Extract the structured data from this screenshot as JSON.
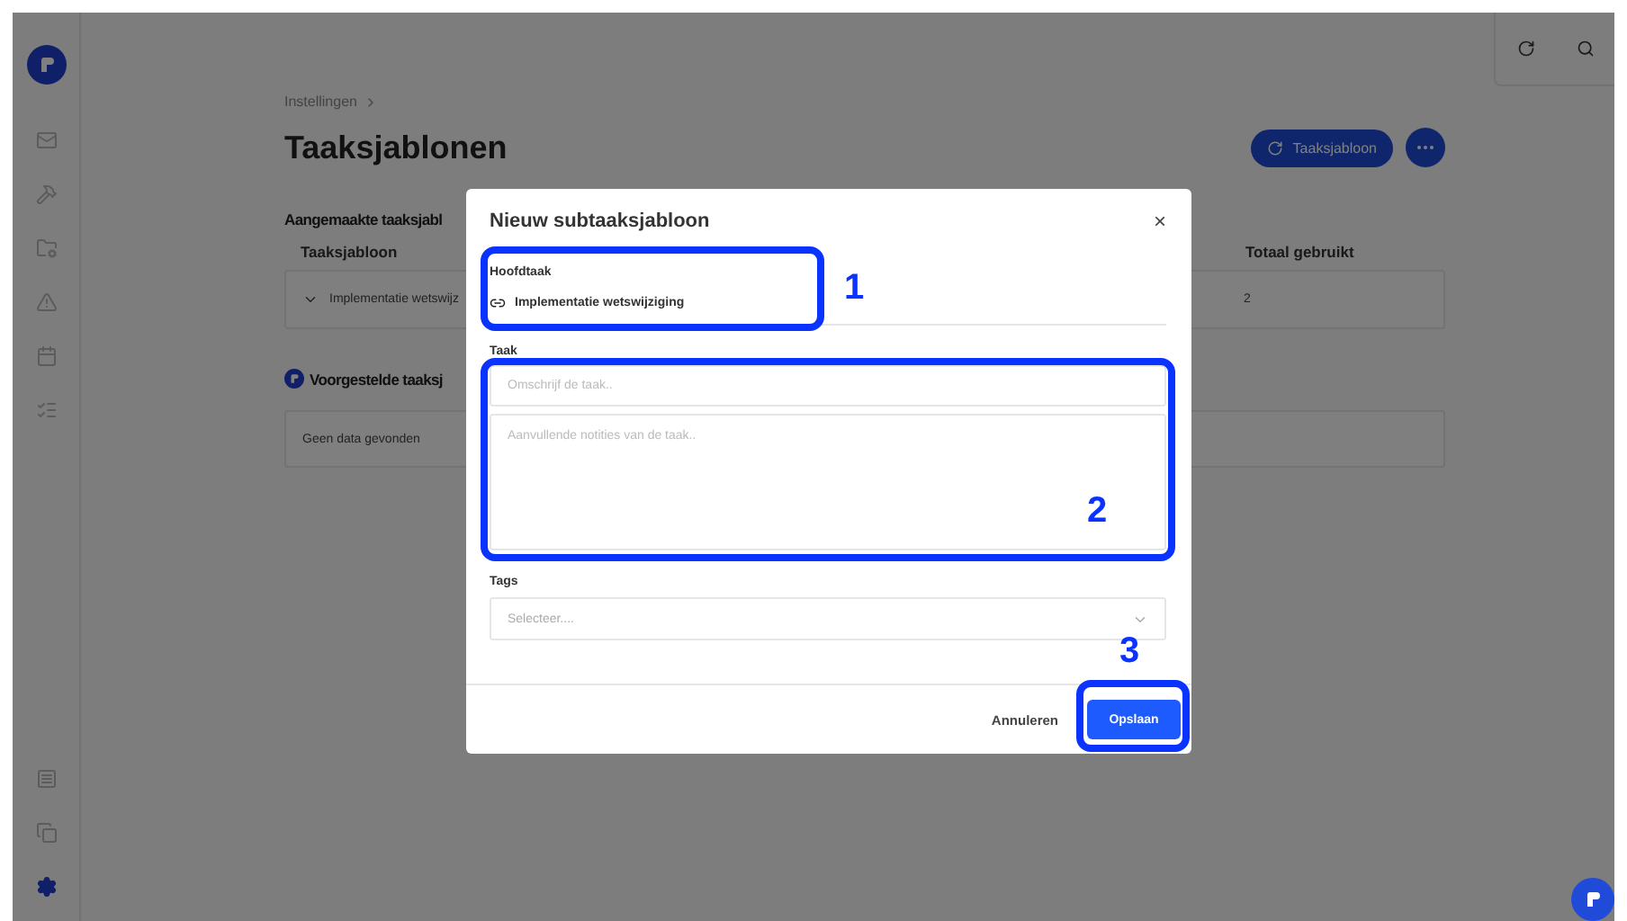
{
  "sidebar": {
    "top_items": [
      {
        "selected": false
      },
      {
        "selected": false
      },
      {
        "selected": false
      },
      {
        "selected": false
      },
      {
        "selected": false
      },
      {
        "selected": false
      }
    ],
    "bottom_items": [
      {
        "selected": false
      },
      {
        "selected": false
      },
      {
        "selected": true
      }
    ]
  },
  "breadcrumb": [
    "Instellingen"
  ],
  "page_title": "Taaksjablonen",
  "actions": {
    "add_button": "Taaksjabloon"
  },
  "created_section": {
    "title": "Aangemaakte taaksjabl",
    "columns": [
      "Taaksjabloon",
      "Totaal gebruikt"
    ],
    "rows": [
      {
        "name": "Implementatie wetswijz",
        "expanded": false,
        "total": "2"
      }
    ]
  },
  "suggested_section": {
    "title": "Voorgestelde taaksj",
    "empty": "Geen data gevonden"
  },
  "dialog": {
    "title": "Nieuw subtaaksjabloon",
    "close": "×",
    "parent_label": "Hoofdtaak",
    "parent_value": "Implementatie wetswijziging",
    "task_label": "Taak",
    "task_placeholder": "Omschrijf de taak..",
    "notes_placeholder": "Aanvullende notities van de taak..",
    "tags_label": "Tags",
    "tags_placeholder": "Selecteer....",
    "cancel": "Annuleren",
    "save": "Opslaan"
  },
  "annotations": [
    {
      "label": "1"
    },
    {
      "label": "2"
    },
    {
      "label": "3"
    }
  ]
}
